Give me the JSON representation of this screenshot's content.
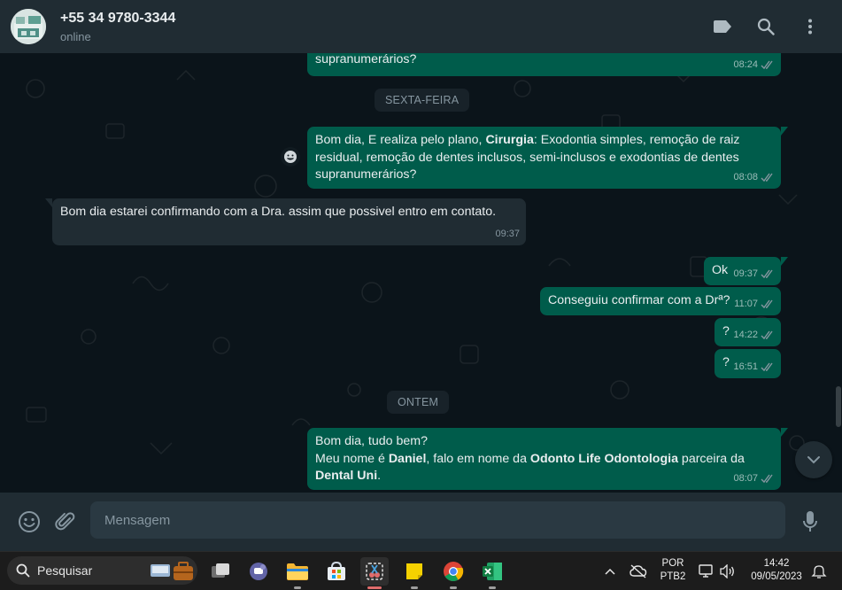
{
  "header": {
    "contact_name": "+55 34 9780-3344",
    "status": "online",
    "icons": [
      "label-icon",
      "search-icon",
      "menu-icon"
    ]
  },
  "messages": {
    "m0": {
      "text": "supranumerários?",
      "time": "08:24"
    },
    "date1": "SEXTA-FEIRA",
    "m1": {
      "part1": "Bom dia, E realiza pelo plano, ",
      "bold1": "Cirurgia",
      "part2": ": Exodontia simples, remoção de raiz residual, remoção de dentes inclusos, semi-inclusos e exodontias de dentes supranumerários?",
      "time": "08:08"
    },
    "m2": {
      "text": "Bom dia estarei confirmando com a Dra. assim que possivel entro em contato.",
      "time": "09:37"
    },
    "m3": {
      "text": "Ok",
      "time": "09:37"
    },
    "m4": {
      "text": "Conseguiu confirmar com a Drª?",
      "time": "11:07"
    },
    "m5": {
      "text": "?",
      "time": "14:22"
    },
    "m6": {
      "text": "?",
      "time": "16:51"
    },
    "date2": "ONTEM",
    "m7": {
      "line1": "Bom dia, tudo bem?",
      "l2a": "Meu nome é ",
      "l2b": "Daniel",
      "l2c": ", falo em nome da ",
      "l2d": "Odonto Life Odontologia",
      "l2e": " parceira da",
      "l3": "Dental Uni",
      "l3b": ".",
      "time": "08:07"
    }
  },
  "composer": {
    "placeholder": "Mensagem",
    "icons": [
      "emoji-icon",
      "attach-icon",
      "mic-icon"
    ]
  },
  "taskbar": {
    "search_label": "Pesquisar",
    "lang1": "POR",
    "lang2": "PTB2",
    "time": "14:42",
    "date": "09/05/2023"
  },
  "colors": {
    "outgoing_bubble": "#005c4b",
    "incoming_bubble": "#202c33",
    "background": "#0b141a",
    "read_tick": "#53bdeb"
  }
}
